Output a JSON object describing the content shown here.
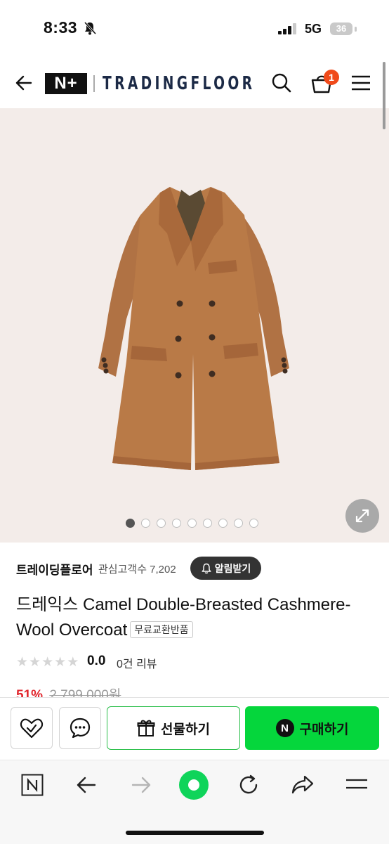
{
  "status_bar": {
    "time": "8:33",
    "network": "5G",
    "battery": "36"
  },
  "header": {
    "logo_badge": "N+",
    "logo_text": "TRADINGFLOOR",
    "cart_count": "1",
    "icons": [
      "back-arrow-icon",
      "search-icon",
      "cart-icon",
      "menu-icon"
    ]
  },
  "gallery": {
    "total_images": 9,
    "active_index": 0
  },
  "store": {
    "name": "트레이딩플로어",
    "fans": "관심고객수 7,202",
    "alert_button": "알림받기"
  },
  "product": {
    "title": "드레익스 Camel Double-Breasted Cashmere-Wool Overcoat",
    "tag": "무료교환반품",
    "rating": "0.0",
    "rating_stars": 0,
    "review_count": "0건 리뷰",
    "discount": "51%",
    "original_price": "2,799,000원"
  },
  "actions": {
    "gift_label": "선물하기",
    "buy_label": "구매하기",
    "buy_badge": "N"
  },
  "colors": {
    "buy_green": "#05d63c",
    "coat_camel": "#b97a47",
    "hero_bg": "#f3ece9",
    "badge_red": "#f04a1a"
  }
}
